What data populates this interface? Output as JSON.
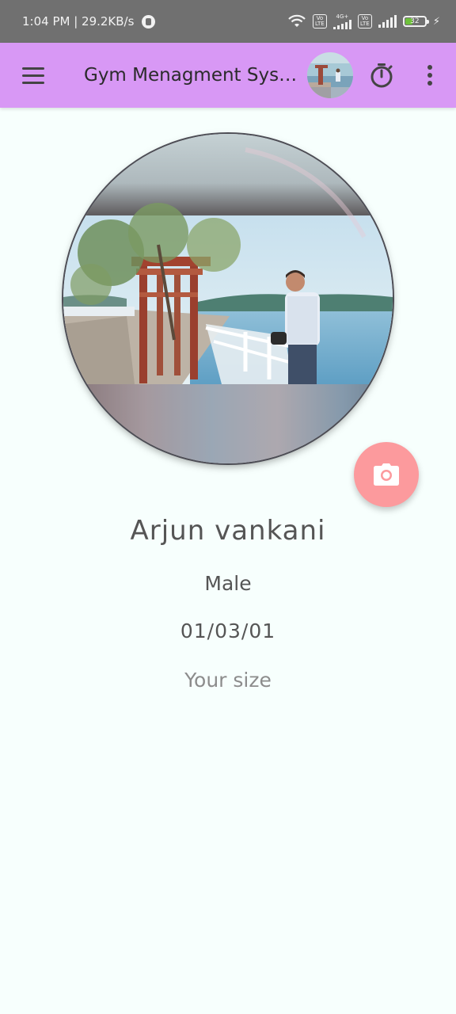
{
  "status_bar": {
    "time_speed": "1:04 PM | 29.2KB/s",
    "sim1": "Vo LTE",
    "sim1_network": "4G+",
    "sim2": "Vo LTE",
    "battery_level": "32"
  },
  "app_bar": {
    "title": "Gym Menagment System",
    "icons": {
      "menu": "hamburger-menu-icon",
      "timer": "stopwatch-icon",
      "more": "more-vertical-icon"
    }
  },
  "profile": {
    "name": "Arjun vankani",
    "gender": "Male",
    "dob": "01/03/01",
    "size_placeholder": "Your size"
  },
  "fab": {
    "icon": "camera-icon",
    "color": "#fc9a9d"
  },
  "colors": {
    "status_bar": "#707070",
    "app_bar": "#d898f5",
    "background": "#f7fffd",
    "text": "#555555"
  }
}
